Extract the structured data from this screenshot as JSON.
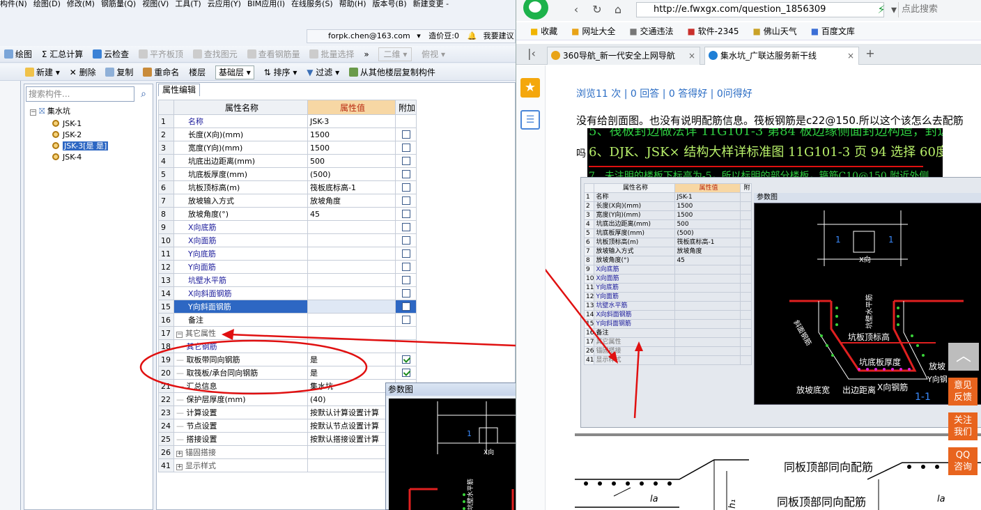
{
  "app": {
    "menu": [
      "构件(N)",
      "绘图(D)",
      "修改(M)",
      "钢筋量(Q)",
      "视图(V)",
      "工具(T)",
      "云应用(Y)",
      "BIM应用(I)",
      "在线服务(S)",
      "帮助(H)",
      "版本号(B)",
      "新建变更 -"
    ],
    "account": {
      "email": "forpk.chen@163.com",
      "price": "造价豆:0",
      "help": "我要建议"
    },
    "toolbar1": {
      "draw": "绘图",
      "sum": "汇总计算",
      "cloud_check": "云检查",
      "align_slab": "平齐板顶",
      "find": "查找图元",
      "view_rebar": "查看钢筋量",
      "batch_select": "批量选择",
      "view_mode": "二维",
      "view_angle": "俯视"
    },
    "toolbar2": {
      "new": "新建",
      "delete": "删除",
      "copy": "复制",
      "rename": "重命名",
      "floor_label": "楼层",
      "floor_value": "基础层",
      "sort": "排序",
      "filter": "过滤",
      "copy_from_floor": "从其他楼层复制构件"
    },
    "tree": {
      "search_placeholder": "搜索构件...",
      "root": "集水坑",
      "items": [
        "JSK-1",
        "JSK-2",
        "JSK-3[是 是]",
        "JSK-4"
      ]
    },
    "props": {
      "tab": "属性编辑",
      "headers": {
        "num": "",
        "name": "属性名称",
        "value": "属性值",
        "extra": "附加"
      },
      "rows": [
        {
          "num": "1",
          "name": "名称",
          "value": "JSK-3",
          "cb": "none",
          "style": "blue"
        },
        {
          "num": "2",
          "name": "长度(X向)(mm)",
          "value": "1500",
          "cb": "off",
          "style": ""
        },
        {
          "num": "3",
          "name": "宽度(Y向)(mm)",
          "value": "1500",
          "cb": "off",
          "style": ""
        },
        {
          "num": "4",
          "name": "坑底出边距离(mm)",
          "value": "500",
          "cb": "off",
          "style": ""
        },
        {
          "num": "5",
          "name": "坑底板厚度(mm)",
          "value": "(500)",
          "cb": "off",
          "style": ""
        },
        {
          "num": "6",
          "name": "坑板顶标高(m)",
          "value": "筏板底标高-1",
          "cb": "off",
          "style": ""
        },
        {
          "num": "7",
          "name": "放坡输入方式",
          "value": "放坡角度",
          "cb": "off",
          "style": ""
        },
        {
          "num": "8",
          "name": "放坡角度(°)",
          "value": "45",
          "cb": "off",
          "style": ""
        },
        {
          "num": "9",
          "name": "X向底筋",
          "value": "",
          "cb": "off",
          "style": "blue"
        },
        {
          "num": "10",
          "name": "X向面筋",
          "value": "",
          "cb": "off",
          "style": "blue"
        },
        {
          "num": "11",
          "name": "Y向底筋",
          "value": "",
          "cb": "off",
          "style": "blue"
        },
        {
          "num": "12",
          "name": "Y向面筋",
          "value": "",
          "cb": "off",
          "style": "blue"
        },
        {
          "num": "13",
          "name": "坑壁水平筋",
          "value": "",
          "cb": "off",
          "style": "blue"
        },
        {
          "num": "14",
          "name": "X向斜面钢筋",
          "value": "",
          "cb": "off",
          "style": "blue"
        },
        {
          "num": "15",
          "name": "Y向斜面钢筋",
          "value": "",
          "cb": "off",
          "style": "sel"
        },
        {
          "num": "16",
          "name": "备注",
          "value": "",
          "cb": "off",
          "style": ""
        },
        {
          "num": "17",
          "name": "其它属性",
          "value": "",
          "cb": "none",
          "style": "group"
        },
        {
          "num": "18",
          "name": "其它钢筋",
          "value": "",
          "cb": "none",
          "style": "sub-blue"
        },
        {
          "num": "19",
          "name": "取板带同向钢筋",
          "value": "是",
          "cb": "on",
          "style": "sub"
        },
        {
          "num": "20",
          "name": "取筏板/承台同向钢筋",
          "value": "是",
          "cb": "on",
          "style": "sub"
        },
        {
          "num": "21",
          "name": "汇总信息",
          "value": "集水坑",
          "cb": "none",
          "style": "sub"
        },
        {
          "num": "22",
          "name": "保护层厚度(mm)",
          "value": "(40)",
          "cb": "none",
          "style": "sub"
        },
        {
          "num": "23",
          "name": "计算设置",
          "value": "按默认计算设置计算",
          "cb": "none",
          "style": "sub"
        },
        {
          "num": "24",
          "name": "节点设置",
          "value": "按默认节点设置计算",
          "cb": "none",
          "style": "sub"
        },
        {
          "num": "25",
          "name": "搭接设置",
          "value": "按默认搭接设置计算",
          "cb": "none",
          "style": "sub"
        },
        {
          "num": "26",
          "name": "锚固搭接",
          "value": "",
          "cb": "none",
          "style": "group2"
        },
        {
          "num": "41",
          "name": "显示样式",
          "value": "",
          "cb": "none",
          "style": "group2"
        }
      ]
    },
    "param_title": "参数图",
    "cad_labels": {
      "one": "1",
      "x": "X向",
      "y": "Y向",
      "wall": "坑壁水平筋"
    }
  },
  "browser": {
    "url": "http://e.fwxgx.com/question_1856309",
    "search_placeholder": "点此搜索",
    "favorites": [
      "收藏",
      "网址大全",
      "交通违法",
      "软件-2345",
      "佛山天气",
      "百度文库"
    ],
    "tabs": [
      {
        "label": "360导航_新一代安全上网导航",
        "active": false,
        "color": "#e8a317"
      },
      {
        "label": "集水坑_广联达服务新干线",
        "active": true,
        "color": "#1f7fd6"
      }
    ],
    "stats": "浏览11 次 | 0 回答 | 0 答得好 | 0问得好",
    "question": "没有给剖面图。也没有说明配筋信息。筏板钢筋是c22@150.所以这个该怎么去配筋",
    "question_end": "吗",
    "img_lines": [
      "5、筏板封边做法详 11G101-3 第84 板边缘侧面封边构造，封边筋 Φ14@150；",
      "6、DJK、JSK× 结构大样详标准图 11G101-3 页 94 选择 60度放坡。",
      "7、未注明的楼板下标高为-5，所以标明的部分楼板，箍筋C10@150,附近外侧"
    ],
    "img_table": {
      "headers": [
        "属性名称",
        "属性值",
        "附"
      ],
      "rows": [
        [
          "1",
          "名称",
          "JSK-1"
        ],
        [
          "2",
          "长度(X向)(mm)",
          "1500"
        ],
        [
          "3",
          "宽度(Y向)(mm)",
          "1500"
        ],
        [
          "4",
          "坑底出边距离(mm)",
          "500"
        ],
        [
          "5",
          "坑底板厚度(mm)",
          "(500)"
        ],
        [
          "6",
          "坑板顶标高(m)",
          "筏板底标高-1"
        ],
        [
          "7",
          "放坡输入方式",
          "放坡角度"
        ],
        [
          "8",
          "放坡角度(°)",
          "45"
        ],
        [
          "9",
          "X向底筋",
          ""
        ],
        [
          "10",
          "X向面筋",
          ""
        ],
        [
          "11",
          "Y向底筋",
          ""
        ],
        [
          "12",
          "Y向面筋",
          ""
        ],
        [
          "13",
          "坑壁水平筋",
          ""
        ],
        [
          "14",
          "X向斜面钢筋",
          ""
        ],
        [
          "15",
          "Y向斜面钢筋",
          ""
        ],
        [
          "16",
          "备注",
          ""
        ],
        [
          "17",
          "其它属性",
          ""
        ],
        [
          "26",
          "锚固搭接",
          ""
        ],
        [
          "41",
          "显示样式",
          ""
        ]
      ]
    },
    "img_param_title": "参数图",
    "cad2_labels": {
      "one": "1",
      "x": "X向",
      "y": "Y向",
      "wall": "坑壁水平筋",
      "slope_rebar": "斜面钢筋",
      "top": "坑板顶标高",
      "thick": "坑底板厚度",
      "slope": "放坡",
      "slope_w": "放坡底宽",
      "edge": "出边距离",
      "xrebar": "X向钢筋",
      "yrebar": "Y向钢",
      "section": "1-1"
    },
    "img3_labels": {
      "a": "同板顶部同向配筋",
      "b": "同板顶部同向配筋",
      "la": "la",
      "h": "h₁"
    },
    "side_buttons": [
      {
        "line1": "意见",
        "line2": "反馈"
      },
      {
        "line1": "关注",
        "line2": "我们"
      },
      {
        "line1": "QQ",
        "line2": "咨询"
      }
    ]
  }
}
